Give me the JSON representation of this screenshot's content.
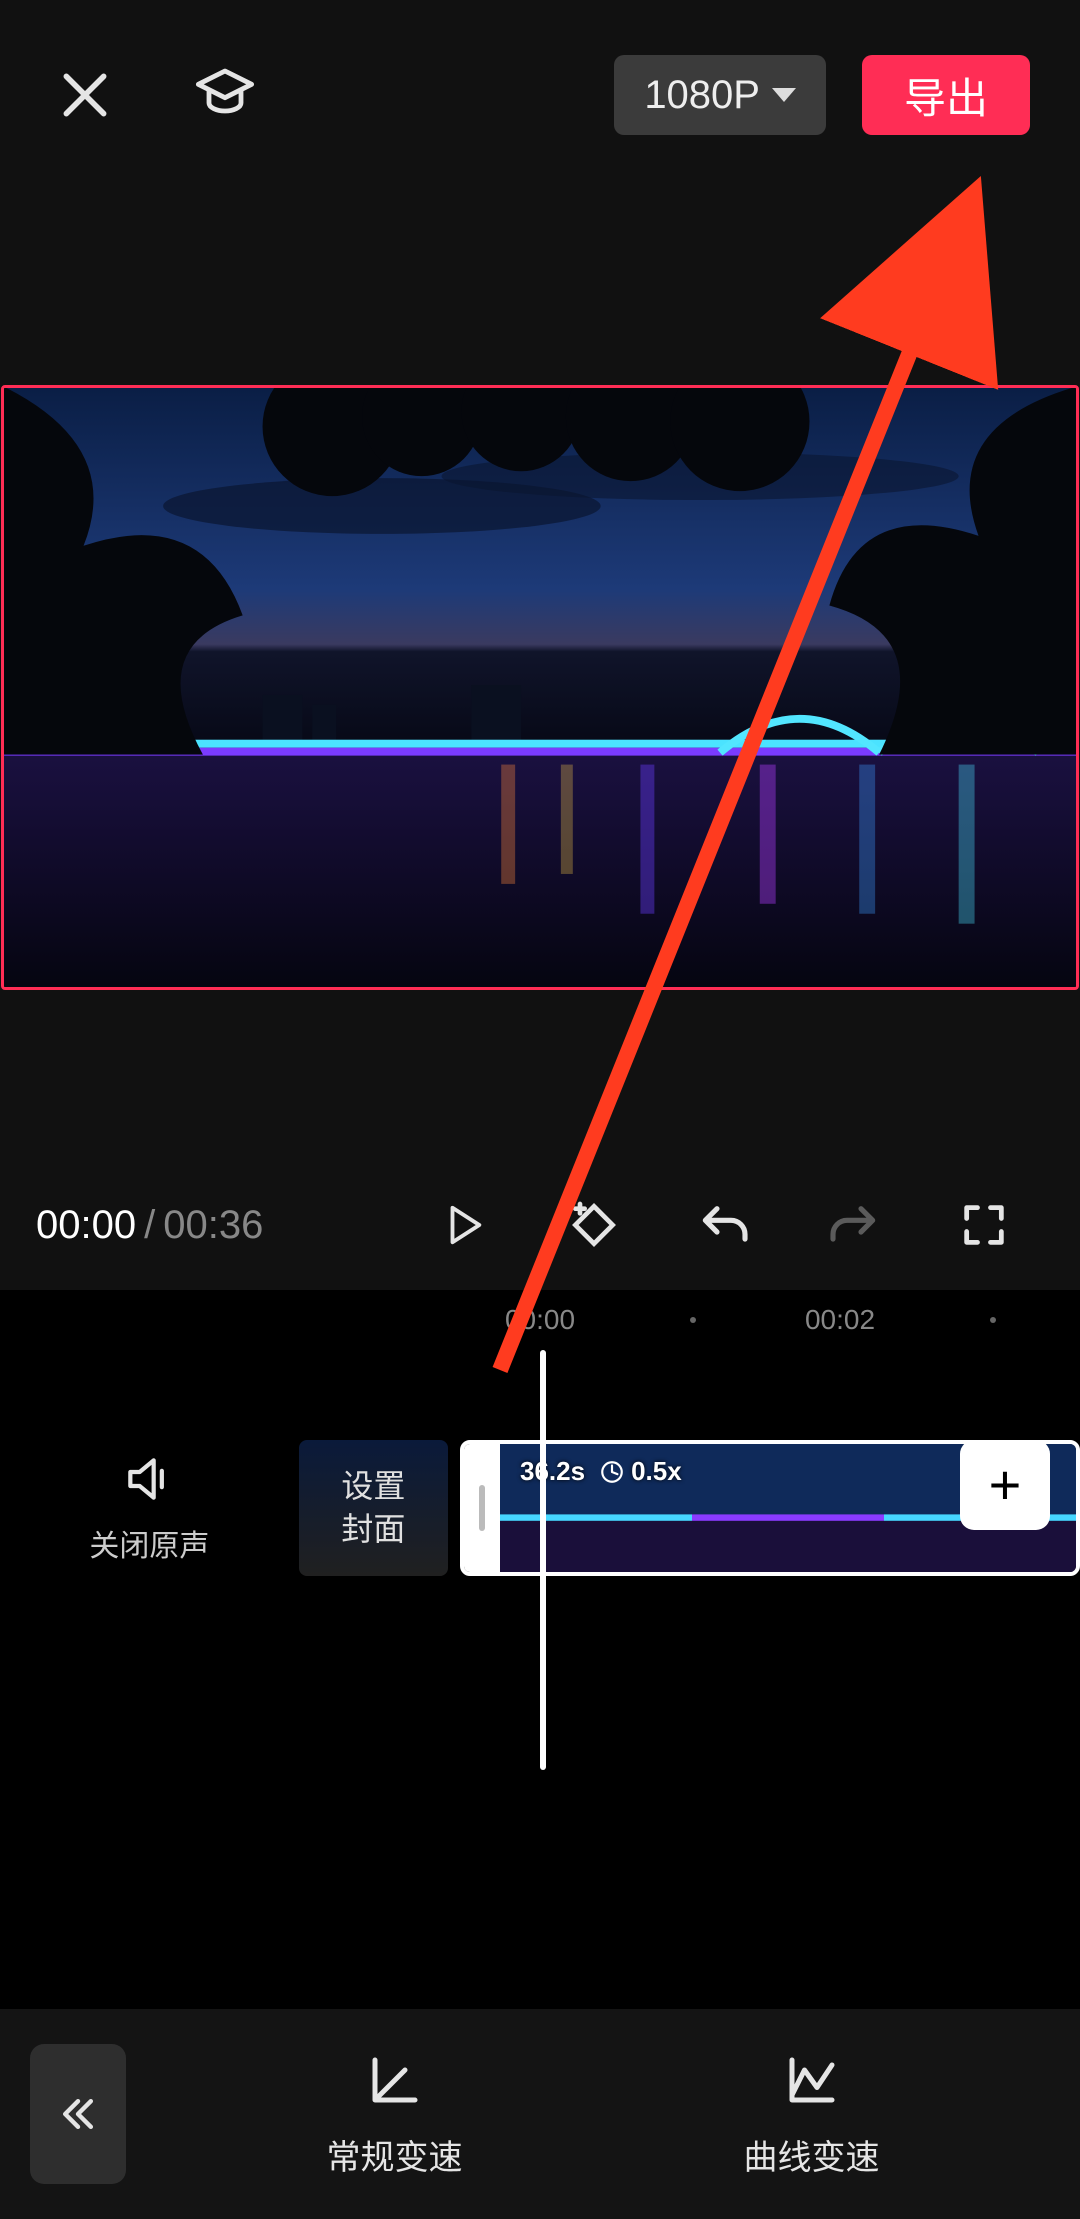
{
  "header": {
    "resolution_label": "1080P",
    "export_label": "导出"
  },
  "playbar": {
    "current_time": "00:00",
    "separator": "/",
    "duration": "00:36"
  },
  "timeline": {
    "ruler": {
      "t0": "00:00",
      "t1": "00:02"
    },
    "mute_label": "关闭原声",
    "cover_label": "设置\n封面",
    "clip": {
      "duration_badge": "36.2s",
      "speed_badge": "0.5x"
    },
    "add_label": "+"
  },
  "bottombar": {
    "tool_normal": "常规变速",
    "tool_curve": "曲线变速"
  },
  "annotation": {
    "arrow_color": "#ff3b1f"
  }
}
